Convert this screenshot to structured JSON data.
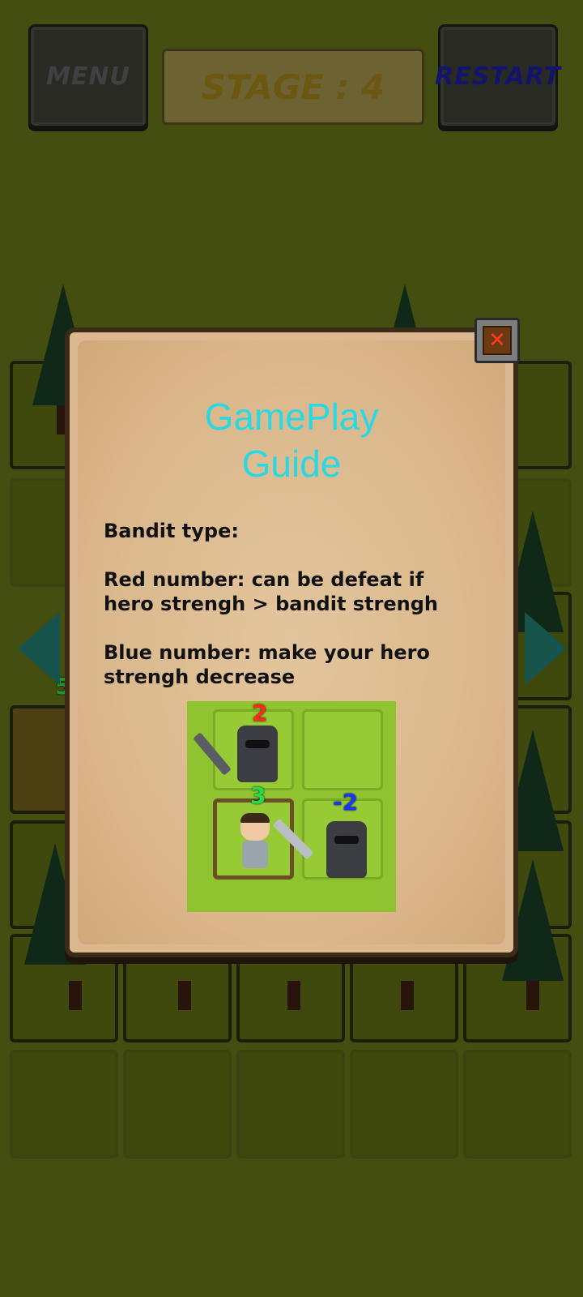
{
  "header": {
    "menu_label": "MENU",
    "stage_label": "STAGE : 4",
    "restart_label": "RESTART"
  },
  "dialog": {
    "title": "GamePlay\nGuide",
    "bandit_type": "Bandit type:",
    "red_number_text": "Red number: can be defeat if\nhero strengh > bandit strengh",
    "blue_number_text": "Blue number: make your hero\nstrengh decrease",
    "close_icon": "close-icon",
    "illustration": {
      "red_value": "2",
      "hero_value": "3",
      "blue_value": "-2"
    }
  },
  "board_partial_number": "5",
  "colors": {
    "title": "#28d8e2",
    "red_number": "#ff2a1a",
    "green_number": "#22e04a",
    "blue_number": "#1438ff",
    "parchment": "#dcb890",
    "grass": "#4e5913"
  }
}
